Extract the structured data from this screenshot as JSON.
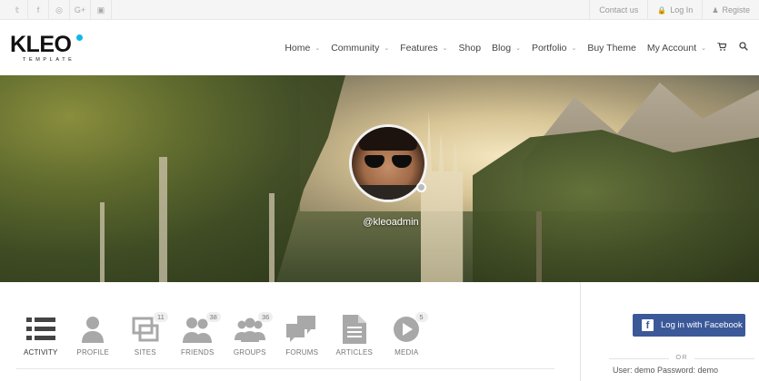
{
  "topbar": {
    "social": [
      {
        "icon": "twitter-icon",
        "glyph": "𝕥"
      },
      {
        "icon": "facebook-icon",
        "glyph": "f"
      },
      {
        "icon": "dribbble-icon",
        "glyph": "◎"
      },
      {
        "icon": "google-plus-icon",
        "glyph": "G+"
      },
      {
        "icon": "youtube-icon",
        "glyph": "▣"
      }
    ],
    "contact": "Contact us",
    "login": "Log In",
    "register": "Registe"
  },
  "logo": {
    "word": "KLEO",
    "sub": "TEMPLATE",
    "accent": "#11b7e8"
  },
  "nav": {
    "items": [
      {
        "label": "Home",
        "dropdown": true
      },
      {
        "label": "Community",
        "dropdown": true
      },
      {
        "label": "Features",
        "dropdown": true
      },
      {
        "label": "Shop",
        "dropdown": false
      },
      {
        "label": "Blog",
        "dropdown": true
      },
      {
        "label": "Portfolio",
        "dropdown": true
      },
      {
        "label": "Buy Theme",
        "dropdown": false
      },
      {
        "label": "My Account",
        "dropdown": true
      }
    ]
  },
  "profile": {
    "username": "@kleoadmin"
  },
  "tabs": [
    {
      "label": "ACTIVITY",
      "icon": "activity-list-icon",
      "badge": null,
      "active": true
    },
    {
      "label": "PROFILE",
      "icon": "person-icon",
      "badge": null,
      "active": false
    },
    {
      "label": "SITES",
      "icon": "sites-icon",
      "badge": "11",
      "active": false
    },
    {
      "label": "FRIENDS",
      "icon": "friends-icon",
      "badge": "38",
      "active": false
    },
    {
      "label": "GROUPS",
      "icon": "groups-icon",
      "badge": "36",
      "active": false
    },
    {
      "label": "FORUMS",
      "icon": "forums-icon",
      "badge": null,
      "active": false
    },
    {
      "label": "ARTICLES",
      "icon": "article-icon",
      "badge": null,
      "active": false
    },
    {
      "label": "MEDIA",
      "icon": "media-play-icon",
      "badge": "5",
      "active": false
    }
  ],
  "sidebar": {
    "facebook_button": "Log in with Facebook",
    "facebook_color": "#3b5998",
    "or": "OR",
    "credentials": "User: demo Password: demo"
  }
}
